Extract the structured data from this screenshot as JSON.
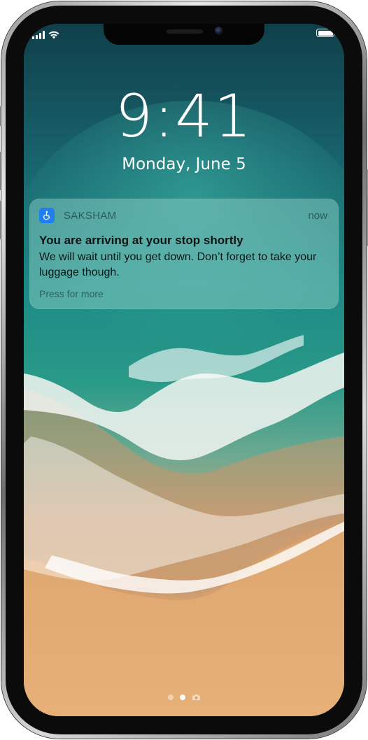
{
  "status_bar": {
    "signal_icon": "cellular-signal-icon",
    "wifi_icon": "wifi-icon",
    "battery_icon": "battery-icon",
    "battery_level": 1.0
  },
  "lock_screen": {
    "time": "9:41",
    "date": "Monday, June 5"
  },
  "notification": {
    "app_icon": "accessibility-wheelchair-icon",
    "app_icon_color": "#1e7ff0",
    "app_name": "SAKSHAM",
    "time": "now",
    "title": "You are arriving at your stop shortly",
    "body": "We will wait until you get down. Don’t forget to take your luggage though.",
    "action_hint": "Press for more"
  },
  "page_indicator": {
    "pages": [
      "dot",
      "dot",
      "camera"
    ],
    "active_index": 1
  }
}
